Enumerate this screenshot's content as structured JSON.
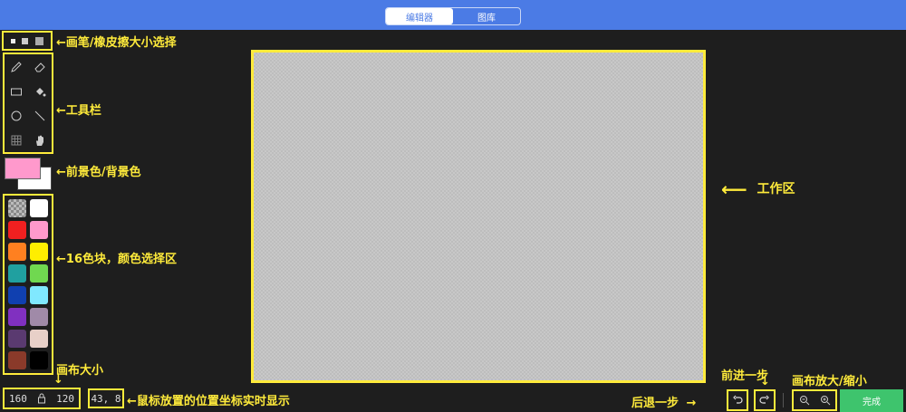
{
  "tabs": [
    {
      "label": "编辑器",
      "active": true
    },
    {
      "label": "图库",
      "active": false
    }
  ],
  "brush_sizes": [
    "small",
    "medium",
    "large"
  ],
  "tools": [
    {
      "icon": "pencil-icon"
    },
    {
      "icon": "eraser-icon"
    },
    {
      "icon": "rectangle-icon"
    },
    {
      "icon": "fill-bucket-icon"
    },
    {
      "icon": "circle-icon"
    },
    {
      "icon": "line-icon"
    },
    {
      "icon": "grid-icon"
    },
    {
      "icon": "hand-icon"
    }
  ],
  "foreground_color": "#ff99cc",
  "background_color": "#ffffff",
  "palette": [
    "transparent",
    "#ffffff",
    "#f02020",
    "#ff99cc",
    "#ff8020",
    "#ffee00",
    "#20a0a0",
    "#70d850",
    "#1040b0",
    "#80e8ff",
    "#8030c0",
    "#a08aa8",
    "#5a3a70",
    "#e8d0c8",
    "#8a3a2a",
    "#000000"
  ],
  "canvas": {
    "width": "160",
    "height": "120",
    "lock_icon": "lock-icon"
  },
  "cursor_position": "43, 8",
  "done_label": "完成",
  "annotations": {
    "brush_size": "←画笔/橡皮擦大小选择",
    "toolbar": "←工具栏",
    "fg_bg": "←前景色/背景色",
    "palette": "←16色块，颜色选择区",
    "work_area": "工作区",
    "canvas_size": "画布大小",
    "cursor_pos": "←鼠标放置的位置坐标实时显示",
    "undo": "后退一步",
    "redo": "前进一步",
    "zoom": "画布放大/缩小"
  }
}
